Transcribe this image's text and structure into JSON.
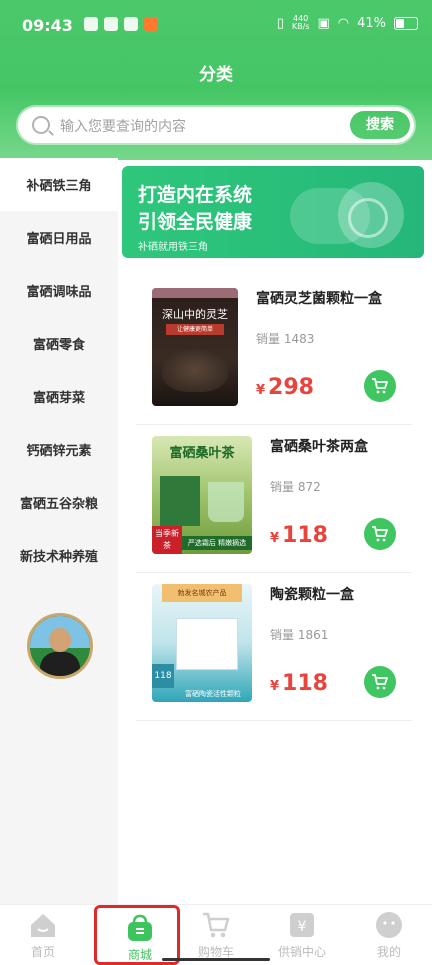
{
  "status": {
    "time": "09:43",
    "net_speed_value": "440",
    "net_speed_unit": "KB/s",
    "battery": "41%"
  },
  "page_title": "分类",
  "search": {
    "placeholder": "输入您要查询的内容",
    "button": "搜索"
  },
  "sidebar": {
    "items": [
      {
        "label": "补硒铁三角",
        "active": true
      },
      {
        "label": "富硒日用品"
      },
      {
        "label": "富硒调味品"
      },
      {
        "label": "富硒零食"
      },
      {
        "label": "富硒芽菜"
      },
      {
        "label": "钙硒锌元素"
      },
      {
        "label": "富硒五谷杂粮"
      },
      {
        "label": "新技术种养殖"
      }
    ]
  },
  "banner": {
    "line1": "打造内在系统",
    "line2": "引领全民健康",
    "sub": "补硒就用铁三角"
  },
  "products": [
    {
      "name": "富硒灵芝菌颗粒一盒",
      "sales_label": "销量",
      "sales": "1483",
      "currency": "¥",
      "price": "298",
      "img_text": "深山中的灵芝",
      "img_sub": "让健康更简单"
    },
    {
      "name": "富硒桑叶茶两盒",
      "sales_label": "销量",
      "sales": "872",
      "currency": "¥",
      "price": "118",
      "img_text": "富硒桑叶茶",
      "img_sub": "严选霜后 精嫩摘选",
      "img_corner": "当季新茶"
    },
    {
      "name": "陶瓷颗粒一盒",
      "sales_label": "销量",
      "sales": "1861",
      "currency": "¥",
      "price": "118",
      "img_text": "勃发名城农产品",
      "img_sub": "富硒陶瓷活性颗粒",
      "img_corner": "118"
    }
  ],
  "tabbar": {
    "items": [
      {
        "label": "首页"
      },
      {
        "label": "商城",
        "active": true
      },
      {
        "label": "购物车"
      },
      {
        "label": "供销中心"
      },
      {
        "label": "我的"
      }
    ]
  },
  "colors": {
    "brand_green": "#3ec45e",
    "price_red": "#e8433d",
    "highlight_red": "#e02a2a"
  }
}
